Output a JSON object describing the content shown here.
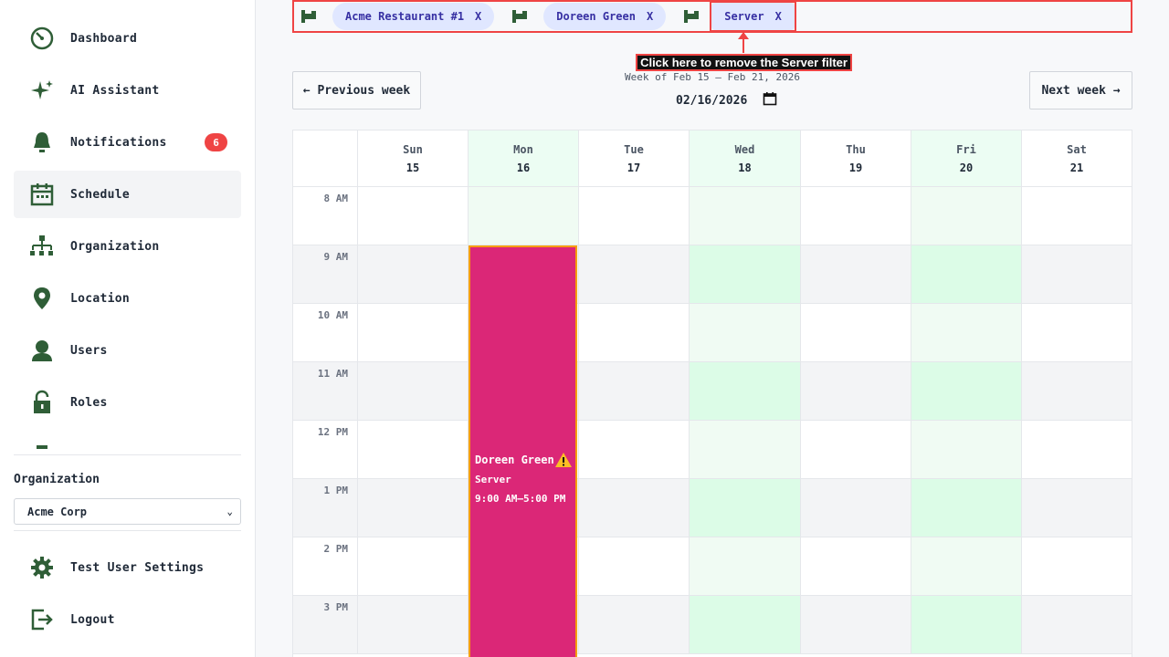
{
  "sidebar": {
    "items": [
      {
        "label": "Dashboard",
        "icon": "dashboard-icon"
      },
      {
        "label": "AI Assistant",
        "icon": "sparkle-icon"
      },
      {
        "label": "Notifications",
        "icon": "bell-icon",
        "badge": "6"
      },
      {
        "label": "Schedule",
        "icon": "calendar-icon",
        "active": true
      },
      {
        "label": "Organization",
        "icon": "org-chart-icon"
      },
      {
        "label": "Location",
        "icon": "location-pin-icon"
      },
      {
        "label": "Users",
        "icon": "user-icon"
      },
      {
        "label": "Roles",
        "icon": "lock-icon"
      }
    ],
    "org_label": "Organization",
    "org_value": "Acme Corp",
    "bottom": [
      {
        "label": "Test User Settings",
        "icon": "gear-icon"
      },
      {
        "label": "Logout",
        "icon": "logout-icon"
      }
    ]
  },
  "filters": {
    "chips": [
      {
        "label": "Acme Restaurant #1",
        "remove": "X"
      },
      {
        "label": "Doreen Green",
        "remove": "X"
      },
      {
        "label": "Server",
        "remove": "X"
      }
    ],
    "tooltip": "Click here to remove the Server filter"
  },
  "week_nav": {
    "prev_label": "← Previous week",
    "next_label": "Next week →",
    "week_label": "Week of Feb 15 – Feb 21, 2026",
    "date_value": "02/16/2026"
  },
  "calendar": {
    "days": [
      {
        "name": "Sun",
        "num": "15"
      },
      {
        "name": "Mon",
        "num": "16"
      },
      {
        "name": "Tue",
        "num": "17"
      },
      {
        "name": "Wed",
        "num": "18"
      },
      {
        "name": "Thu",
        "num": "19"
      },
      {
        "name": "Fri",
        "num": "20"
      },
      {
        "name": "Sat",
        "num": "21"
      }
    ],
    "hours": [
      "8 AM",
      "9 AM",
      "10 AM",
      "11 AM",
      "12 PM",
      "1 PM",
      "2 PM",
      "3 PM"
    ],
    "shift": {
      "name": "Doreen Green",
      "role": "Server",
      "time": "9:00 AM–5:00 PM"
    }
  },
  "colors": {
    "accent": "#db2777",
    "warning": "#f59e0b",
    "badge": "#ef4444",
    "icon": "#2f5e37"
  }
}
